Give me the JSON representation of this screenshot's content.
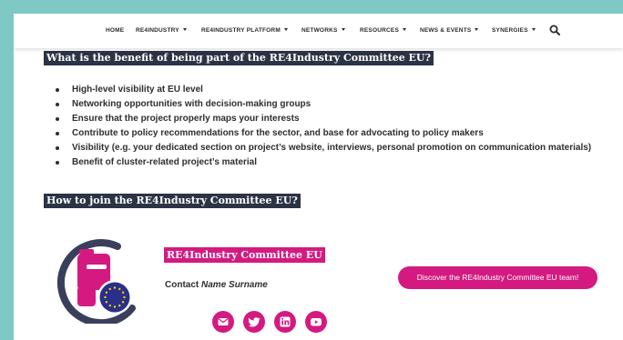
{
  "nav": {
    "items": [
      {
        "label": "HOME",
        "dropdown": false
      },
      {
        "label": "RE4INDUSTRY",
        "dropdown": true
      },
      {
        "label": "RE4INDUSTRY PLATFORM",
        "dropdown": true
      },
      {
        "label": "NETWORKS",
        "dropdown": true
      },
      {
        "label": "RESOURCES",
        "dropdown": true
      },
      {
        "label": "NEWS & EVENTS",
        "dropdown": true
      },
      {
        "label": "SYNERGIES",
        "dropdown": true
      }
    ],
    "search_icon": "search-icon"
  },
  "benefits": {
    "heading": "What is the benefit of being part of the RE4Industry Committee EU?",
    "items": [
      "High-level visibility at EU level",
      "Networking opportunities with decision-making groups",
      "Ensure that the project properly maps your interests",
      "Contribute to policy recommendations for the sector, and base for advocating to policy makers",
      "Visibility (e.g. your dedicated section on project’s website, interviews, personal promotion on communication materials)",
      "Benefit of cluster-related project’s material"
    ]
  },
  "join": {
    "heading": "How to join the RE4Industry Committee EU?",
    "committee_name": "RE4Industry Committee EU",
    "contact_label": "Contact",
    "contact_name": "Name Surname",
    "discover_button": "Discover the RE4Industry Committee EU team!",
    "social_icons": [
      "email-icon",
      "twitter-icon",
      "linkedin-icon",
      "youtube-icon"
    ]
  },
  "colors": {
    "background": "#7fc9c5",
    "accent": "#d41a80",
    "heading_bg": "#2c3345",
    "logo_ring": "#3a3f5c",
    "eu_blue": "#2a2f8a",
    "eu_star": "#f5d400"
  }
}
